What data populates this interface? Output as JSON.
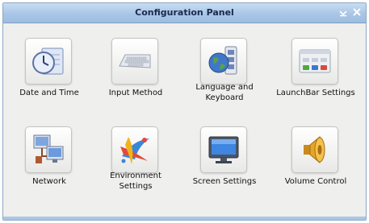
{
  "window": {
    "title": "Configuration Panel",
    "controls": {
      "minimize_icon": "minimize-icon",
      "close_icon": "close-icon"
    }
  },
  "items": [
    {
      "label": "Date and Time",
      "icon": "clock-icon"
    },
    {
      "label": "Input Method",
      "icon": "keyboard-icon"
    },
    {
      "label_line1": "Language and",
      "label_line2": "Keyboard",
      "icon": "globe-keyboard-icon"
    },
    {
      "label": "LaunchBar Settings",
      "icon": "launchbar-icon"
    },
    {
      "label": "Network",
      "icon": "network-computers-icon"
    },
    {
      "label_line1": "Environment",
      "label_line2": "Settings",
      "icon": "environment-swirl-icon"
    },
    {
      "label": "Screen Settings",
      "icon": "monitor-icon"
    },
    {
      "label": "Volume Control",
      "icon": "speaker-icon"
    }
  ],
  "colors": {
    "titlebar": "#a9c6e6",
    "background": "#efefed",
    "border": "#8fa8c2"
  }
}
